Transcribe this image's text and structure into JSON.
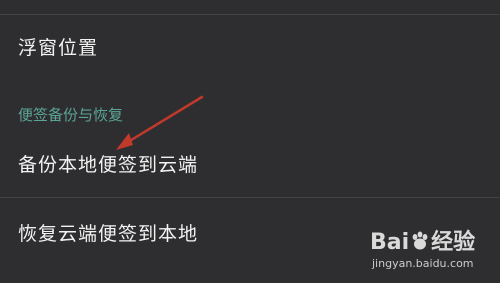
{
  "settings": {
    "items": [
      {
        "label": "浮窗位置"
      },
      {
        "label": "备份本地便签到云端"
      },
      {
        "label": "恢复云端便签到本地"
      }
    ],
    "section_header": "便签备份与恢复"
  },
  "watermark": {
    "brand": "Bai",
    "brand_suffix": "经验",
    "url": "jingyan.baidu.com"
  },
  "annotation": {
    "arrow_color": "#c0392b"
  },
  "theme": {
    "background": "#2e2e30",
    "text": "#f2f2f2",
    "section_color": "#5aa596",
    "divider": "#434345"
  }
}
